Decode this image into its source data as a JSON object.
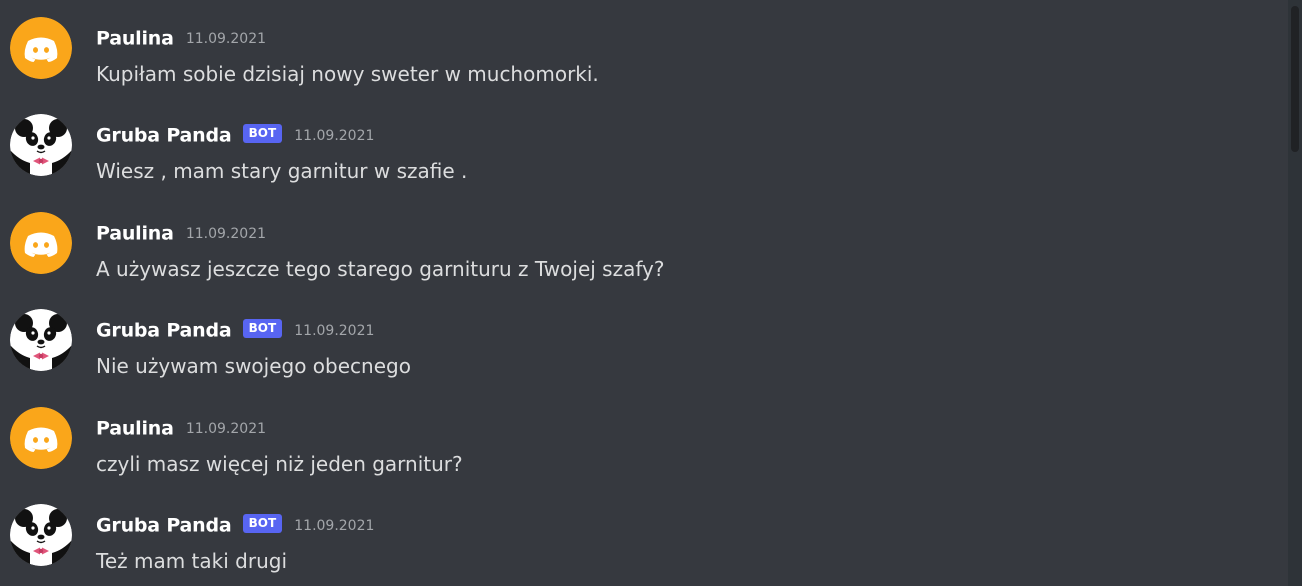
{
  "theme": {
    "background": "#36393f",
    "bot_badge_color": "#5865f2",
    "user_avatar_color": "#faa61a"
  },
  "messages": [
    {
      "author": "Paulina",
      "avatar": "discord-logo-icon",
      "bot": false,
      "timestamp": "11.09.2021",
      "text": "Kupiłam sobie dzisiaj nowy sweter w muchomorki."
    },
    {
      "author": "Gruba Panda",
      "avatar": "panda-icon",
      "bot": true,
      "badge": "BOT",
      "timestamp": "11.09.2021",
      "text": "Wiesz , mam stary garnitur w szafie ."
    },
    {
      "author": "Paulina",
      "avatar": "discord-logo-icon",
      "bot": false,
      "timestamp": "11.09.2021",
      "text": "A używasz jeszcze tego starego garnituru z Twojej szafy?"
    },
    {
      "author": "Gruba Panda",
      "avatar": "panda-icon",
      "bot": true,
      "badge": "BOT",
      "timestamp": "11.09.2021",
      "text": "Nie używam swojego obecnego"
    },
    {
      "author": "Paulina",
      "avatar": "discord-logo-icon",
      "bot": false,
      "timestamp": "11.09.2021",
      "text": "czyli masz więcej niż jeden garnitur?"
    },
    {
      "author": "Gruba Panda",
      "avatar": "panda-icon",
      "bot": true,
      "badge": "BOT",
      "timestamp": "11.09.2021",
      "text": "Też mam taki drugi"
    }
  ]
}
